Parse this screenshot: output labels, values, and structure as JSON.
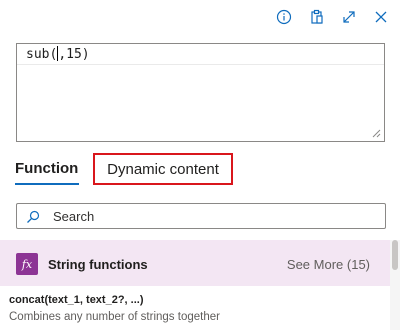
{
  "toolbar": {
    "icons": [
      "info-icon",
      "clipboard-icon",
      "expand-icon",
      "close-icon"
    ]
  },
  "editor": {
    "before_caret": "sub(",
    "after_caret": ",15)"
  },
  "tabs": {
    "function_label": "Function",
    "dynamic_label": "Dynamic content"
  },
  "search": {
    "placeholder": "Search"
  },
  "category": {
    "icon_text": "fx",
    "title": "String functions",
    "see_more": "See More (15)"
  },
  "functions": [
    {
      "signature": "concat(text_1, text_2?, ...)",
      "description": "Combines any number of strings together"
    }
  ],
  "colors": {
    "accent": "#0f6cbd",
    "highlight_border": "#d9161c",
    "category_bg": "#f3e6f3",
    "fx_badge": "#8c3494"
  }
}
